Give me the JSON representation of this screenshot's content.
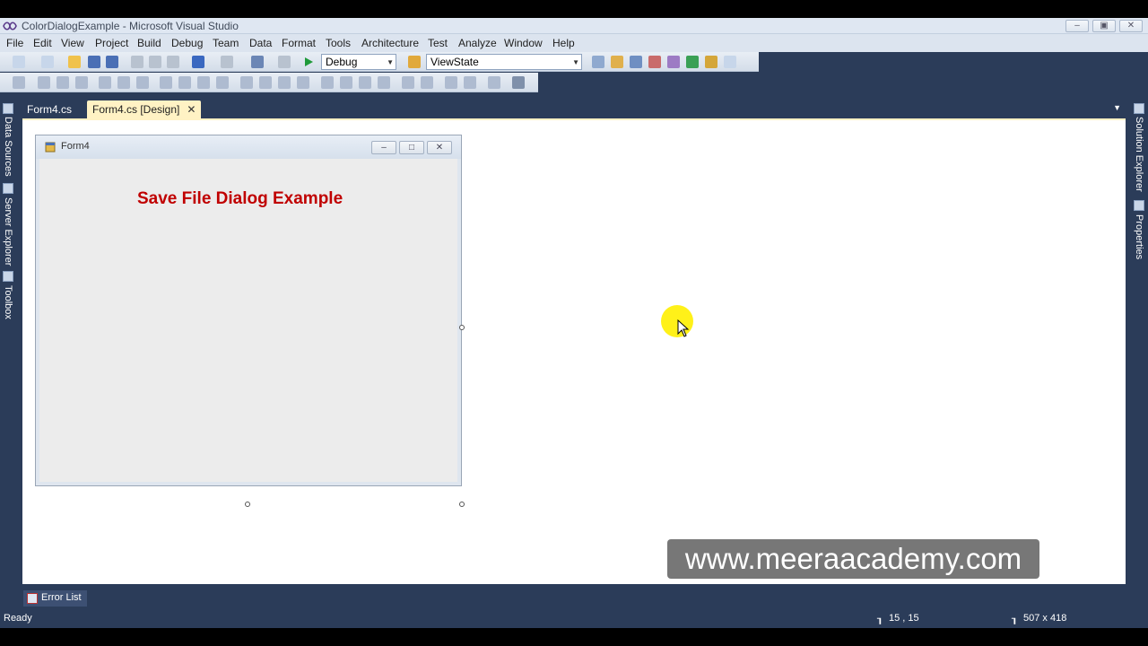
{
  "window": {
    "title": "ColorDialogExample - Microsoft Visual Studio"
  },
  "menu": [
    "File",
    "Edit",
    "View",
    "Project",
    "Build",
    "Debug",
    "Team",
    "Data",
    "Format",
    "Tools",
    "Architecture",
    "Test",
    "Analyze",
    "Window",
    "Help"
  ],
  "toolbar": {
    "config": "Debug",
    "target": "ViewState"
  },
  "tabs": [
    {
      "label": "Form4.cs",
      "active": false
    },
    {
      "label": "Form4.cs [Design]",
      "active": true
    }
  ],
  "left_rail": [
    "Data Sources",
    "Server Explorer",
    "Toolbox"
  ],
  "right_rail": [
    "Solution Explorer",
    "Properties"
  ],
  "form": {
    "title": "Form4",
    "label": "Save File Dialog Example",
    "label_color": "#c00000"
  },
  "watermark": "www.meeraacademy.com",
  "error_list": "Error List",
  "status": {
    "text": "Ready",
    "position": "15 , 15",
    "size": "507 x 418"
  },
  "colors": {
    "chrome": "#2b3c59",
    "active_tab": "#fff2c4",
    "highlight": "#ffef00"
  }
}
